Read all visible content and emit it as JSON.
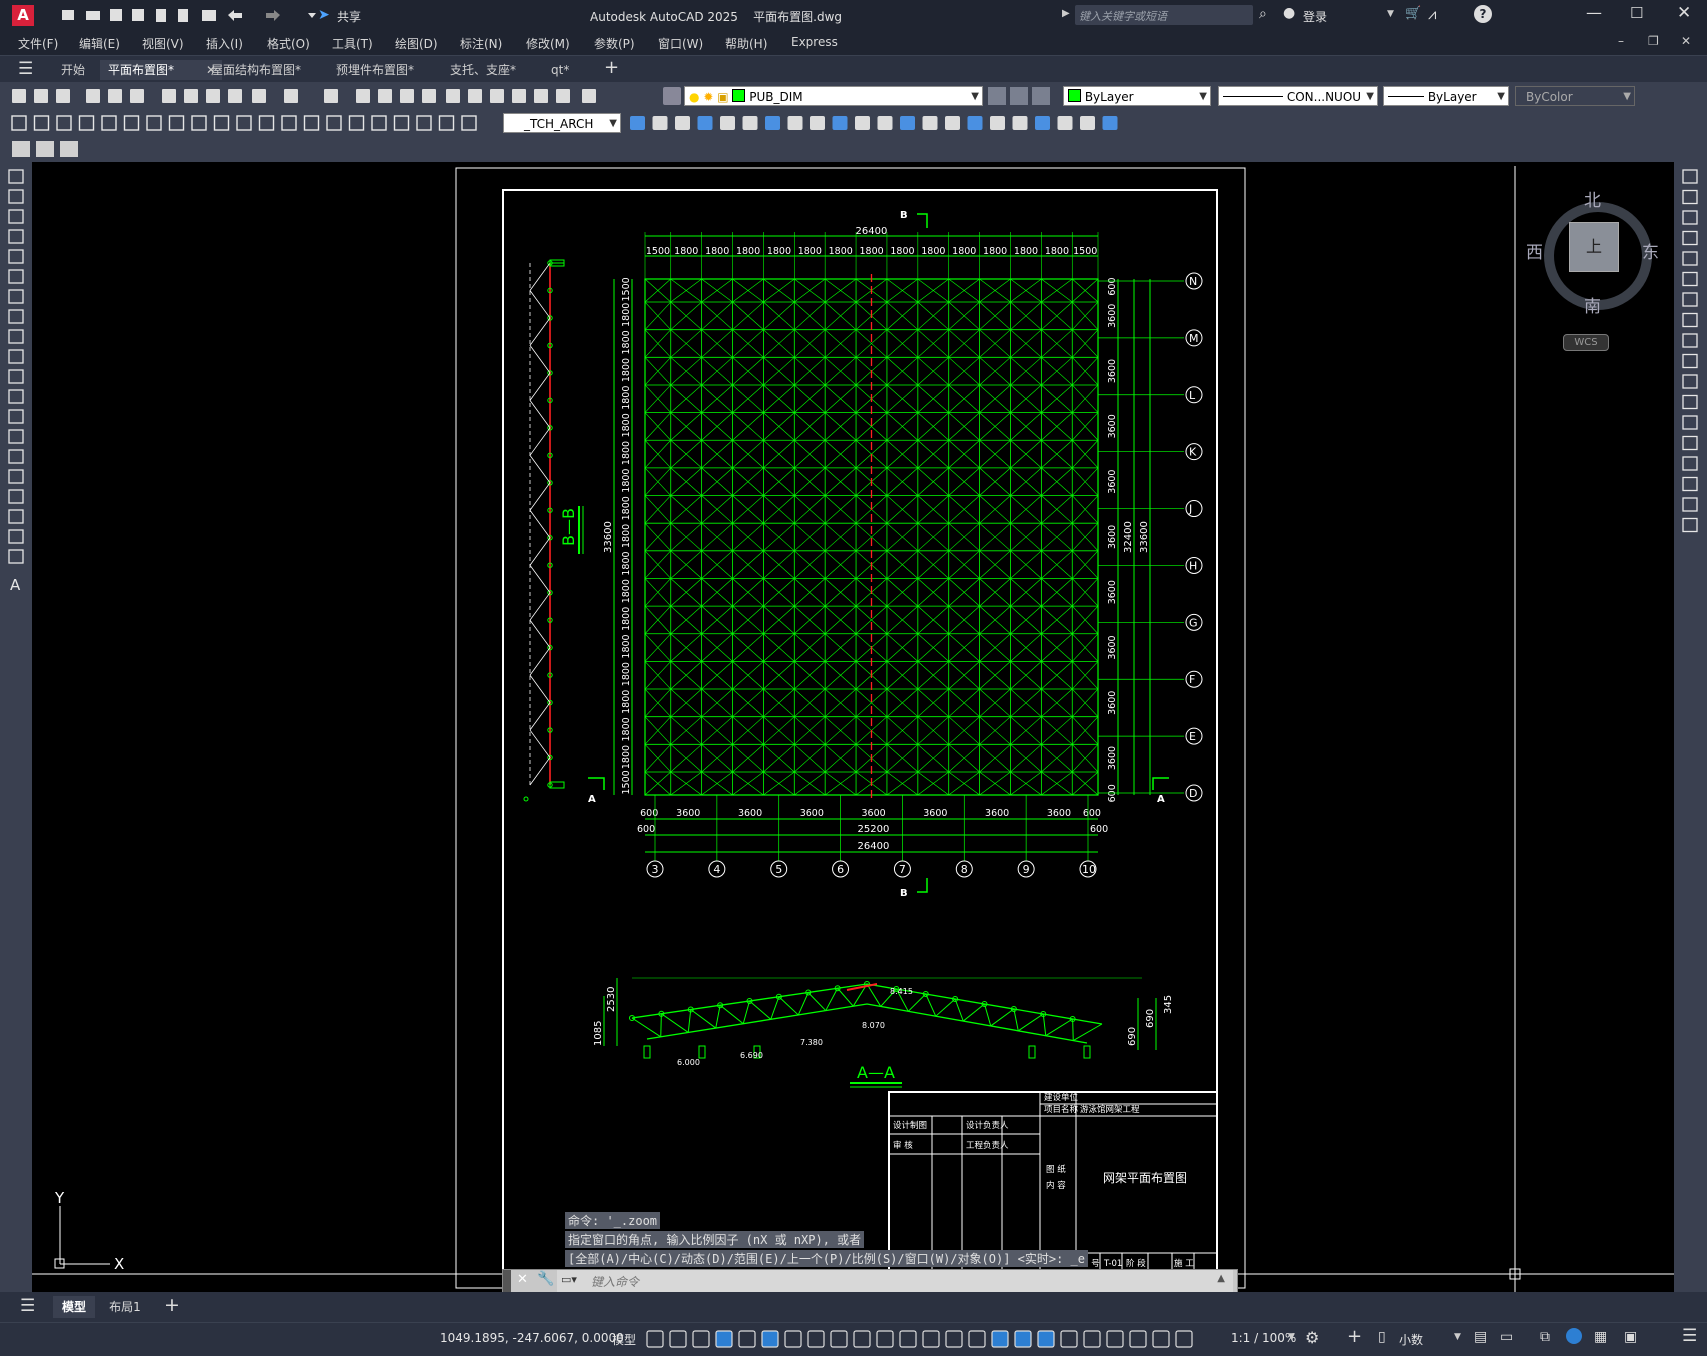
{
  "titlebar": {
    "title": "Autodesk AutoCAD 2025    平面布置图.dwg",
    "share_label": "共享",
    "search_placeholder": "键入关键字或短语",
    "login_label": "登录"
  },
  "menu": [
    "文件(F)",
    "编辑(E)",
    "视图(V)",
    "插入(I)",
    "格式(O)",
    "工具(T)",
    "绘图(D)",
    "标注(N)",
    "修改(M)",
    "参数(P)",
    "窗口(W)",
    "帮助(H)",
    "Express"
  ],
  "tabs": [
    {
      "label": "开始",
      "active": false,
      "closable": false
    },
    {
      "label": "平面布置图*",
      "active": true,
      "closable": true
    },
    {
      "label": "屋面结构布置图*",
      "active": false,
      "closable": false
    },
    {
      "label": "预埋件布置图*",
      "active": false,
      "closable": false
    },
    {
      "label": "支托、支座*",
      "active": false,
      "closable": false
    },
    {
      "label": "qt*",
      "active": false,
      "closable": false
    }
  ],
  "toolbar": {
    "layer_value": "PUB_DIM",
    "color_value": "ByLayer",
    "linetype_value": "CON...NUOU",
    "lineweight_value": "ByLayer",
    "plotstyle_value": "ByColor",
    "textstyle_value": "_TCH_ARCH"
  },
  "viewcube": {
    "north": "北",
    "south": "南",
    "east": "东",
    "west": "西",
    "top": "上",
    "wcs": "WCS"
  },
  "drawing": {
    "plan_top_total": "26400",
    "plan_top_bays": [
      "1500",
      "1800",
      "1800",
      "1800",
      "1800",
      "1800",
      "1800",
      "1800",
      "1800",
      "1800",
      "1800",
      "1800",
      "1800",
      "1800",
      "1500"
    ],
    "plan_left_bays": [
      "1500",
      "1800",
      "1800",
      "1800",
      "1800",
      "1800",
      "1800",
      "1800",
      "1800",
      "1800",
      "1800",
      "1800",
      "1800",
      "1800",
      "1800",
      "1800",
      "1800",
      "1800",
      "1500"
    ],
    "plan_left_total": "33600",
    "plan_right_bays": [
      "600",
      "3600",
      "3600",
      "3600",
      "3600",
      "3600",
      "3600",
      "3600",
      "3600",
      "3600",
      "600"
    ],
    "plan_right_total1": "32400",
    "plan_right_total2": "33600",
    "plan_bottom_bays": [
      "600",
      "3600",
      "3600",
      "3600",
      "3600",
      "3600",
      "3600",
      "3600",
      "600"
    ],
    "plan_bottom_total1": "25200",
    "plan_bottom_total2": "26400",
    "row_axes": [
      "N",
      "M",
      "L",
      "K",
      "J",
      "H",
      "G",
      "F",
      "E",
      "D"
    ],
    "col_axes": [
      "3",
      "4",
      "5",
      "6",
      "7",
      "8",
      "9",
      "10"
    ],
    "section_label_b": "B",
    "section_label_a": "A",
    "section_bb_title": "B—B",
    "section_aa_title": "A—A",
    "aa_levels": [
      "6.000",
      "6.690",
      "7.380",
      "8.070",
      "8.415"
    ],
    "aa_left_dims": [
      "1085",
      "2530"
    ],
    "aa_right_dims": [
      "690",
      "690",
      "345"
    ],
    "titleblock": {
      "build_unit": "建设单位",
      "project_name": "项目名称",
      "project_value": "游泳馆网架工程",
      "design_draw": "设计制图",
      "design_lead": "设计负责人",
      "review": "审 核",
      "engineer_lead": "工程负责人",
      "drawing_name_label": "图 纸",
      "content_label": "内 容",
      "drawing_title": "网架平面布置图",
      "drawing_no_label": "图 号",
      "drawing_no": "T-01",
      "stage_label": "阶 段",
      "stage_value": "施 工"
    }
  },
  "command": {
    "history": [
      "命令: '_.zoom",
      "指定窗口的角点, 输入比例因子 (nX 或 nXP), 或者",
      "[全部(A)/中心(C)/动态(D)/范围(E)/上一个(P)/比例(S)/窗口(W)/对象(O)] <实时>: _e"
    ],
    "placeholder": "键入命令"
  },
  "ucs": {
    "x": "X",
    "y": "Y"
  },
  "layouts": [
    {
      "label": "模型",
      "active": true
    },
    {
      "label": "布局1",
      "active": false
    }
  ],
  "status": {
    "coords": "1049.1895, -247.6067, 0.0000",
    "model": "模型",
    "scale": "1:1 / 100%",
    "units": "小数"
  },
  "colors": {
    "frame": "#1f2430",
    "toolbar": "#3a4050",
    "grid": "#00ff00",
    "white": "#ffffff",
    "red": "#ff2020",
    "accent": "#2d7fd3"
  }
}
